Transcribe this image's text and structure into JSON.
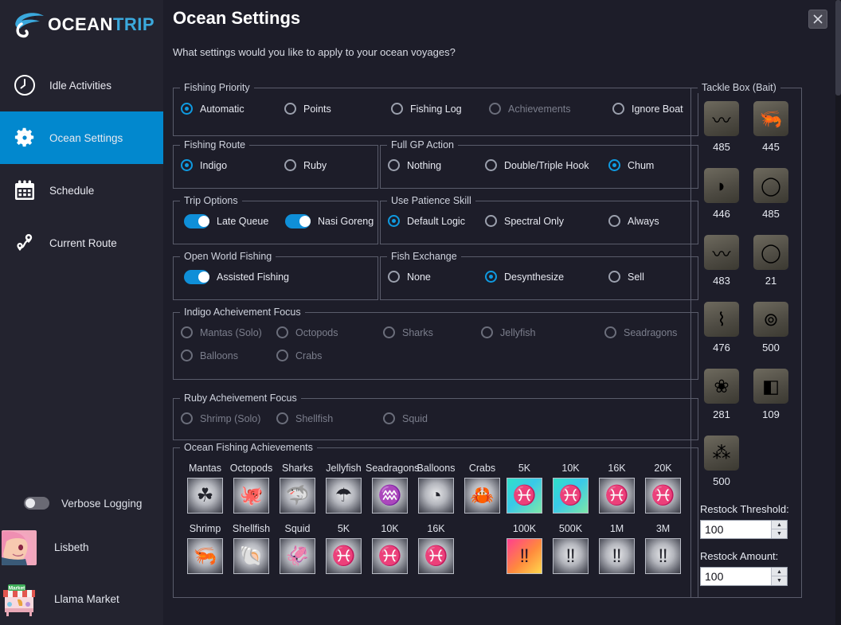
{
  "app": {
    "brand_ocean": "OCEAN",
    "brand_trip": "TRIP",
    "logo_icon": "fish-hook-logo-icon"
  },
  "sidebar": {
    "items": [
      {
        "label": "Idle Activities",
        "icon": "clock-icon",
        "active": false
      },
      {
        "label": "Ocean Settings",
        "icon": "gear-icon",
        "active": true
      },
      {
        "label": "Schedule",
        "icon": "calendar-icon",
        "active": false
      },
      {
        "label": "Current Route",
        "icon": "route-pins-icon",
        "active": false
      }
    ],
    "verbose_logging": {
      "label": "Verbose Logging",
      "on": false
    },
    "account": {
      "name": "Lisbeth",
      "avatar_icon": "character-avatar"
    },
    "market": {
      "name": "Llama Market",
      "icon": "market-stall-icon"
    }
  },
  "header": {
    "title": "Ocean Settings",
    "subtitle": "What settings would you like to apply to your ocean voyages?",
    "close_label": "×",
    "close_icon": "close-icon"
  },
  "groups": {
    "fishing_priority": {
      "legend": "Fishing Priority",
      "options": [
        {
          "label": "Automatic",
          "selected": true,
          "disabled": false
        },
        {
          "label": "Points",
          "selected": false,
          "disabled": false
        },
        {
          "label": "Fishing Log",
          "selected": false,
          "disabled": false
        },
        {
          "label": "Achievements",
          "selected": false,
          "disabled": true
        },
        {
          "label": "Ignore Boat",
          "selected": false,
          "disabled": false
        }
      ]
    },
    "fishing_route": {
      "legend": "Fishing Route",
      "options": [
        {
          "label": "Indigo",
          "selected": true,
          "disabled": false
        },
        {
          "label": "Ruby",
          "selected": false,
          "disabled": false
        }
      ]
    },
    "full_gp_action": {
      "legend": "Full GP Action",
      "options": [
        {
          "label": "Nothing",
          "selected": false,
          "disabled": false
        },
        {
          "label": "Double/Triple Hook",
          "selected": false,
          "disabled": false
        },
        {
          "label": "Chum",
          "selected": true,
          "disabled": false
        }
      ]
    },
    "trip_options": {
      "legend": "Trip Options",
      "toggles": [
        {
          "label": "Late Queue",
          "on": true
        },
        {
          "label": "Nasi Goreng",
          "on": true
        }
      ]
    },
    "use_patience_skill": {
      "legend": "Use Patience Skill",
      "options": [
        {
          "label": "Default Logic",
          "selected": true,
          "disabled": false
        },
        {
          "label": "Spectral Only",
          "selected": false,
          "disabled": false
        },
        {
          "label": "Always",
          "selected": false,
          "disabled": false
        }
      ]
    },
    "open_world_fishing": {
      "legend": "Open World Fishing",
      "toggles": [
        {
          "label": "Assisted Fishing",
          "on": true
        }
      ]
    },
    "fish_exchange": {
      "legend": "Fish Exchange",
      "options": [
        {
          "label": "None",
          "selected": false,
          "disabled": false
        },
        {
          "label": "Desynthesize",
          "selected": true,
          "disabled": false
        },
        {
          "label": "Sell",
          "selected": false,
          "disabled": false
        }
      ]
    },
    "indigo_focus": {
      "legend": "Indigo Acheivement Focus",
      "options": [
        {
          "label": "Mantas (Solo)",
          "selected": false,
          "disabled": true
        },
        {
          "label": "Octopods",
          "selected": false,
          "disabled": true
        },
        {
          "label": "Sharks",
          "selected": false,
          "disabled": true
        },
        {
          "label": "Jellyfish",
          "selected": false,
          "disabled": true
        },
        {
          "label": "Seadragons",
          "selected": false,
          "disabled": true
        },
        {
          "label": "Balloons",
          "selected": false,
          "disabled": true
        },
        {
          "label": "Crabs",
          "selected": false,
          "disabled": true
        }
      ]
    },
    "ruby_focus": {
      "legend": "Ruby Acheivement Focus",
      "options": [
        {
          "label": "Shrimp (Solo)",
          "selected": false,
          "disabled": true
        },
        {
          "label": "Shellfish",
          "selected": false,
          "disabled": true
        },
        {
          "label": "Squid",
          "selected": false,
          "disabled": true
        }
      ]
    },
    "achievements": {
      "legend": "Ocean Fishing Achievements",
      "row1": [
        {
          "label": "Mantas",
          "icon": "manta-ray-icon",
          "style": "gray",
          "glyph": "☘"
        },
        {
          "label": "Octopods",
          "icon": "octopus-icon",
          "style": "gray",
          "glyph": "🐙"
        },
        {
          "label": "Sharks",
          "icon": "shark-icon",
          "style": "gray",
          "glyph": "🦈"
        },
        {
          "label": "Jellyfish",
          "icon": "jellyfish-icon",
          "style": "gray",
          "glyph": "☂"
        },
        {
          "label": "Seadragons",
          "icon": "seahorse-icon",
          "style": "gray",
          "glyph": "♒"
        },
        {
          "label": "Balloons",
          "icon": "balloonfish-icon",
          "style": "gray",
          "glyph": "◔"
        },
        {
          "label": "Crabs",
          "icon": "crab-icon",
          "style": "gray",
          "glyph": "🦀"
        },
        {
          "label": "5K",
          "icon": "fish-count-icon",
          "style": "teal",
          "glyph": "♓"
        },
        {
          "label": "10K",
          "icon": "fish-count-icon",
          "style": "teal",
          "glyph": "♓"
        },
        {
          "label": "16K",
          "icon": "fish-count-icon",
          "style": "gray",
          "glyph": "♓"
        },
        {
          "label": "20K",
          "icon": "fish-count-icon",
          "style": "gray",
          "glyph": "♓"
        }
      ],
      "row2": [
        {
          "label": "Shrimp",
          "icon": "shrimp-icon",
          "style": "gray",
          "glyph": "🦐"
        },
        {
          "label": "Shellfish",
          "icon": "scallop-icon",
          "style": "gray",
          "glyph": "🐚"
        },
        {
          "label": "Squid",
          "icon": "squid-icon",
          "style": "gray",
          "glyph": "🦑"
        },
        {
          "label": "5K",
          "icon": "fish-count-icon",
          "style": "gray",
          "glyph": "♓"
        },
        {
          "label": "10K",
          "icon": "fish-count-icon",
          "style": "gray",
          "glyph": "♓"
        },
        {
          "label": "16K",
          "icon": "fish-count-icon",
          "style": "gray",
          "glyph": "♓"
        },
        {
          "label": "",
          "icon": "empty-slot",
          "style": "none",
          "glyph": ""
        },
        {
          "label": "100K",
          "icon": "points-icon",
          "style": "pink",
          "glyph": "‼"
        },
        {
          "label": "500K",
          "icon": "points-icon",
          "style": "gray",
          "glyph": "‼"
        },
        {
          "label": "1M",
          "icon": "points-icon",
          "style": "gray",
          "glyph": "‼"
        },
        {
          "label": "3M",
          "icon": "points-icon",
          "style": "gray",
          "glyph": "‼"
        }
      ]
    },
    "tackle_box": {
      "legend": "Tackle Box (Bait)",
      "baits": [
        {
          "qty": "485",
          "icon": "ragworm-bait-icon",
          "glyph": "〰"
        },
        {
          "qty": "445",
          "icon": "krill-bait-icon",
          "glyph": "🦐"
        },
        {
          "qty": "446",
          "icon": "pill-bug-bait-icon",
          "glyph": "◗"
        },
        {
          "qty": "485",
          "icon": "rat-tail-bait-icon",
          "glyph": "◯"
        },
        {
          "qty": "483",
          "icon": "plump-worm-bait-icon",
          "glyph": "〰"
        },
        {
          "qty": "21",
          "icon": "spoon-lure-bait-icon",
          "glyph": "◯"
        },
        {
          "qty": "476",
          "icon": "heavy-steel-jig-icon",
          "glyph": "⌇"
        },
        {
          "qty": "500",
          "icon": "glowworm-bait-icon",
          "glyph": "⊚"
        },
        {
          "qty": "281",
          "icon": "silver-spoon-lure-icon",
          "glyph": "❀"
        },
        {
          "qty": "109",
          "icon": "shrimp-cage-feeder-icon",
          "glyph": "◧"
        },
        {
          "qty": "500",
          "icon": "mayfly-bait-icon",
          "glyph": "⁂"
        }
      ],
      "restock_threshold": {
        "label": "Restock Threshold:",
        "value": "100"
      },
      "restock_amount": {
        "label": "Restock Amount:",
        "value": "100"
      }
    }
  },
  "colors": {
    "background": "#1d1d29",
    "sidebar": "#23232f",
    "accent": "#0288ce",
    "accent_bright": "#0f9ae0",
    "border": "#5a5c6b",
    "text": "#e6e8f0",
    "text_dim": "#7b7e8c"
  }
}
